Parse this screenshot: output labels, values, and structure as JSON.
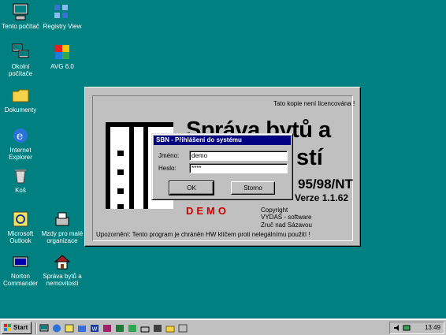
{
  "desktop": {
    "icons": [
      {
        "label_lines": [
          "Tento počítač"
        ],
        "icon": "computer-icon"
      },
      {
        "label_lines": [
          "Registry View"
        ],
        "icon": "registry-icon"
      },
      {
        "label_lines": [
          "Okolní",
          "počítače"
        ],
        "icon": "network-icon"
      },
      {
        "label_lines": [
          "AVG 6.0"
        ],
        "icon": "avg-icon"
      },
      {
        "label_lines": [
          "Dokumenty"
        ],
        "icon": "folder-icon"
      },
      {
        "label_lines": [
          "Internet",
          "Explorer"
        ],
        "icon": "ie-icon"
      },
      {
        "label_lines": [
          "Koš"
        ],
        "icon": "recycle-bin-icon"
      },
      {
        "label_lines": [
          "Microsoft",
          "Outlook"
        ],
        "icon": "outlook-icon"
      },
      {
        "label_lines": [
          "Mzdy pro malé",
          "organizace"
        ],
        "icon": "payroll-icon"
      },
      {
        "label_lines": [
          "Norton",
          "Commander"
        ],
        "icon": "norton-icon"
      },
      {
        "label_lines": [
          "Správa bytů a",
          "nemovitostí"
        ],
        "icon": "house-icon"
      }
    ]
  },
  "splash": {
    "license_note": "Tato kopie není licencována !",
    "title_line1": "Správa bytů a",
    "title_line2": "stí",
    "platform": "95/98/NT",
    "version": "Verze 1.1.62",
    "demo": "DEMO",
    "copyright": "Copyright",
    "company": "VYDAS - software",
    "location": "Zruč nad Sázavou",
    "warning": "Upozornění: Tento program je chráněn HW klíčem proti nelegálnímu použití !"
  },
  "login": {
    "title": "SBN - Přihlášení do systému",
    "name_label": "Jméno:",
    "name_value": "demo",
    "password_label": "Heslo:",
    "password_value": "****",
    "ok_label": "OK",
    "cancel_label": "Storno"
  },
  "taskbar": {
    "start_label": "Start",
    "clock": "13:49"
  },
  "colors": {
    "desktop": "#008080",
    "titlebar": "#000080",
    "demo": "#cc0000"
  }
}
